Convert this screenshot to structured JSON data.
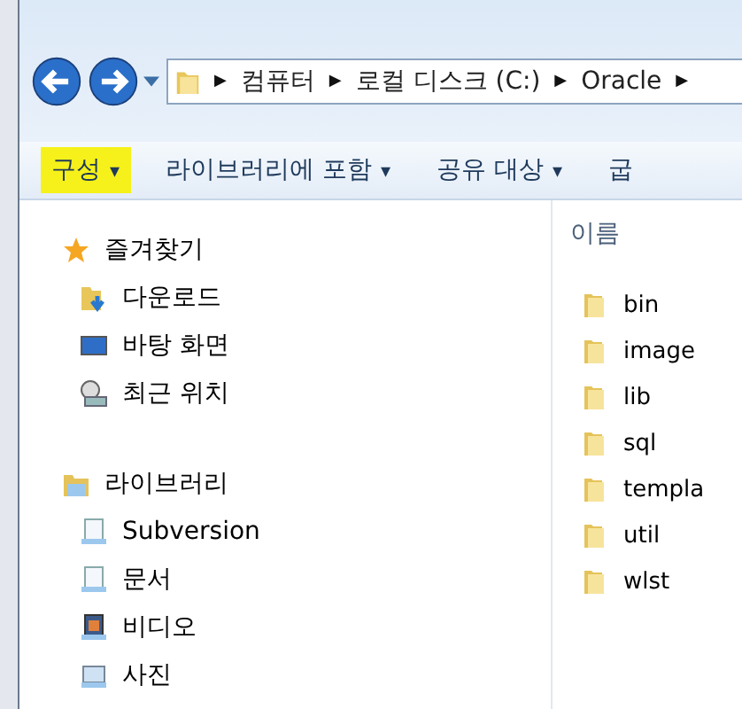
{
  "address_bar": {
    "separator": "▶",
    "crumbs": [
      "컴퓨터",
      "로컬 디스크 (C:)",
      "Oracle"
    ]
  },
  "toolbar": [
    {
      "label": "구성",
      "arrow": "▾",
      "selected": true
    },
    {
      "label": "라이브러리에 포함",
      "arrow": "▾",
      "selected": false
    },
    {
      "label": "공유 대상",
      "arrow": "▾",
      "selected": false
    },
    {
      "label": "굽",
      "selected": false
    }
  ],
  "sidebar": {
    "groups": [
      {
        "label": "즐겨찾기",
        "kind": "star",
        "children": [
          {
            "label": "다운로드",
            "kind": "download"
          },
          {
            "label": "바탕 화면",
            "kind": "desktop"
          },
          {
            "label": "최근 위치",
            "kind": "recent"
          }
        ]
      },
      {
        "label": "라이브러리",
        "kind": "library",
        "children": [
          {
            "label": "Subversion",
            "kind": "document"
          },
          {
            "label": "문서",
            "kind": "document"
          },
          {
            "label": "비디오",
            "kind": "video"
          },
          {
            "label": "사진",
            "kind": "picture"
          }
        ]
      }
    ]
  },
  "file_list": {
    "column": "이름",
    "items": [
      "bin",
      "image",
      "lib",
      "sql",
      "templa",
      "util",
      "wlst"
    ]
  }
}
